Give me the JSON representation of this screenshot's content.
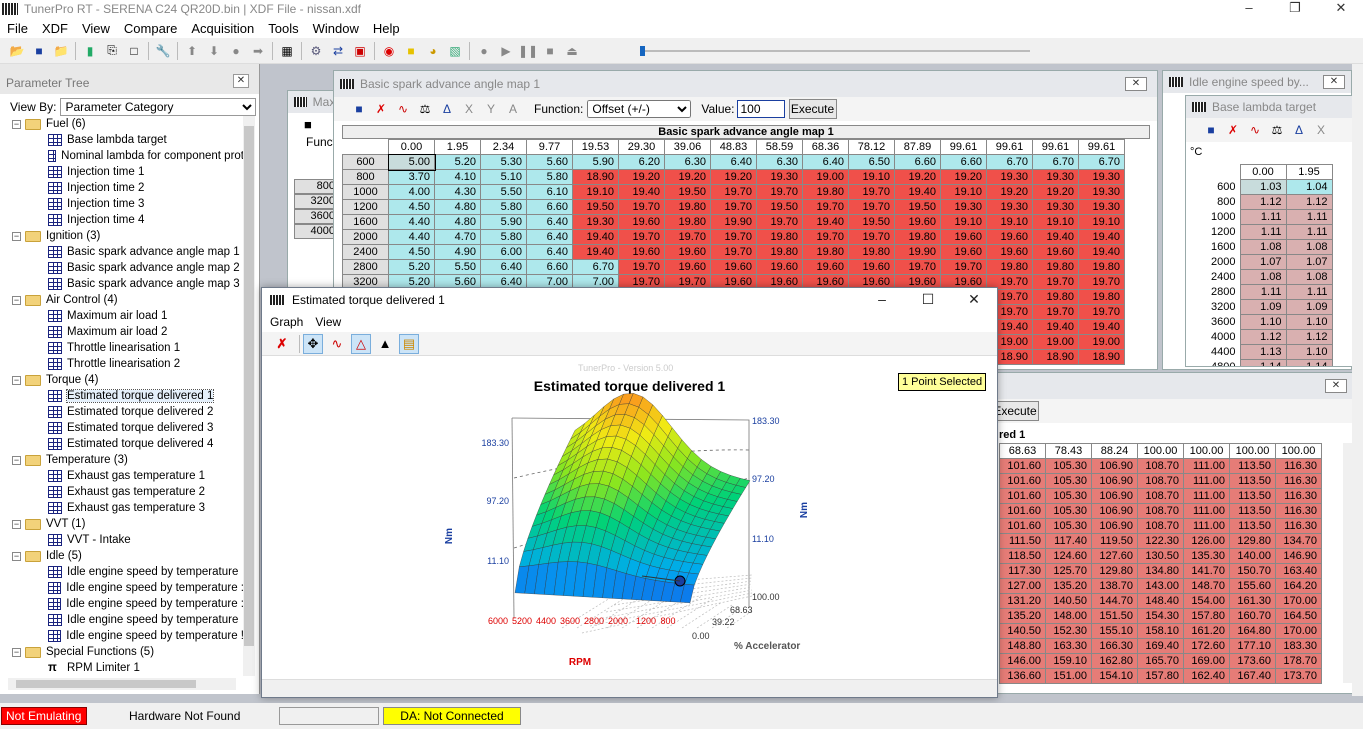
{
  "app": {
    "title": "TunerPro RT - SERENA C24 QR20D.bin | XDF File - nissan.xdf"
  },
  "menu": [
    "File",
    "XDF",
    "View",
    "Compare",
    "Acquisition",
    "Tools",
    "Window",
    "Help"
  ],
  "param_tree": {
    "header": "Parameter Tree",
    "view_by_label": "View By:",
    "view_by_value": "Parameter Category",
    "groups": [
      {
        "label": "Fuel (6)",
        "items": [
          "Base lambda target",
          "Nominal lambda for component prot",
          "Injection time 1",
          "Injection time 2",
          "Injection time 3",
          "Injection time 4"
        ]
      },
      {
        "label": "Ignition (3)",
        "items": [
          "Basic spark advance angle map 1",
          "Basic spark advance angle map 2",
          "Basic spark advance angle map 3"
        ]
      },
      {
        "label": "Air Control (4)",
        "items": [
          "Maximum air load 1",
          "Maximum air load 2",
          "Throttle linearisation 1",
          "Throttle linearisation 2"
        ]
      },
      {
        "label": "Torque (4)",
        "items": [
          "Estimated torque delivered 1",
          "Estimated torque delivered 2",
          "Estimated torque delivered 3",
          "Estimated torque delivered 4"
        ]
      },
      {
        "label": "Temperature (3)",
        "items": [
          "Exhaust gas temperature 1",
          "Exhaust gas temperature 2",
          "Exhaust gas temperature 3"
        ]
      },
      {
        "label": "VVT (1)",
        "items": [
          "VVT - Intake"
        ]
      },
      {
        "label": "Idle (5)",
        "items": [
          "Idle engine speed by temperature",
          "Idle engine speed by temperature :",
          "Idle engine speed by temperature :",
          "Idle engine speed by temperature",
          "Idle engine speed by temperature !"
        ]
      },
      {
        "label": "Special Functions (5)",
        "items": [
          "RPM Limiter 1"
        ]
      }
    ]
  },
  "spark": {
    "title": "Basic spark advance angle map 1",
    "function_label": "Function:",
    "function_value": "Offset (+/-)",
    "value_label": "Value:",
    "value": "100",
    "execute": "Execute",
    "table_title": "Basic spark advance angle map 1",
    "cols": [
      "0.00",
      "1.95",
      "2.34",
      "9.77",
      "19.53",
      "29.30",
      "39.06",
      "48.83",
      "58.59",
      "68.36",
      "78.12",
      "87.89",
      "99.61",
      "99.61",
      "99.61",
      "99.61"
    ],
    "rows": [
      {
        "y": "600",
        "v": [
          "5.00",
          "5.20",
          "5.30",
          "5.60",
          "5.90",
          "6.20",
          "6.30",
          "6.40",
          "6.30",
          "6.40",
          "6.50",
          "6.60",
          "6.60",
          "6.70",
          "6.70",
          "6.70"
        ]
      },
      {
        "y": "800",
        "v": [
          "3.70",
          "4.10",
          "5.10",
          "5.80",
          "18.90",
          "19.20",
          "19.20",
          "19.20",
          "19.30",
          "19.00",
          "19.10",
          "19.20",
          "19.20",
          "19.30",
          "19.30",
          "19.30"
        ]
      },
      {
        "y": "1000",
        "v": [
          "4.00",
          "4.30",
          "5.50",
          "6.10",
          "19.10",
          "19.40",
          "19.50",
          "19.70",
          "19.70",
          "19.80",
          "19.70",
          "19.40",
          "19.10",
          "19.20",
          "19.20",
          "19.30"
        ]
      },
      {
        "y": "1200",
        "v": [
          "4.50",
          "4.80",
          "5.80",
          "6.60",
          "19.50",
          "19.70",
          "19.80",
          "19.70",
          "19.50",
          "19.70",
          "19.70",
          "19.50",
          "19.30",
          "19.30",
          "19.30",
          "19.30"
        ]
      },
      {
        "y": "1600",
        "v": [
          "4.40",
          "4.80",
          "5.90",
          "6.40",
          "19.30",
          "19.60",
          "19.80",
          "19.90",
          "19.70",
          "19.40",
          "19.50",
          "19.60",
          "19.10",
          "19.10",
          "19.10",
          "19.10"
        ]
      },
      {
        "y": "2000",
        "v": [
          "4.40",
          "4.70",
          "5.80",
          "6.40",
          "19.40",
          "19.70",
          "19.70",
          "19.70",
          "19.80",
          "19.70",
          "19.70",
          "19.80",
          "19.60",
          "19.60",
          "19.40",
          "19.40"
        ]
      },
      {
        "y": "2400",
        "v": [
          "4.50",
          "4.90",
          "6.00",
          "6.40",
          "19.40",
          "19.60",
          "19.60",
          "19.70",
          "19.80",
          "19.80",
          "19.80",
          "19.90",
          "19.60",
          "19.60",
          "19.60",
          "19.40"
        ]
      },
      {
        "y": "2800",
        "v": [
          "5.20",
          "5.50",
          "6.40",
          "6.60",
          "6.70",
          "19.70",
          "19.60",
          "19.60",
          "19.60",
          "19.60",
          "19.60",
          "19.70",
          "19.70",
          "19.80",
          "19.80",
          "19.80"
        ]
      },
      {
        "y": "3200",
        "v": [
          "5.20",
          "5.60",
          "6.40",
          "7.00",
          "7.00",
          "19.70",
          "19.70",
          "19.60",
          "19.60",
          "19.60",
          "19.60",
          "19.60",
          "19.60",
          "19.70",
          "19.70",
          "19.70"
        ]
      }
    ],
    "extra_rows": [
      [
        "19.70",
        "19.80",
        "19.80"
      ],
      [
        "19.70",
        "19.70",
        "19.70"
      ],
      [
        "19.40",
        "19.40",
        "19.40"
      ],
      [
        "19.00",
        "19.00",
        "19.00"
      ],
      [
        "18.90",
        "18.90",
        "18.90"
      ]
    ]
  },
  "left_partial": {
    "title": "Maxi",
    "func": "Functi",
    "rows": [
      "800",
      "3200",
      "3600",
      "4000"
    ]
  },
  "idle": {
    "title": "Idle engine speed by..."
  },
  "lambda": {
    "title": "Base lambda target",
    "unit": "°C",
    "cols": [
      "0.00",
      "1.95"
    ],
    "rows": [
      {
        "y": "600",
        "v": [
          "1.03",
          "1.04"
        ]
      },
      {
        "y": "800",
        "v": [
          "1.12",
          "1.12"
        ]
      },
      {
        "y": "1000",
        "v": [
          "1.11",
          "1.11"
        ]
      },
      {
        "y": "1200",
        "v": [
          "1.11",
          "1.11"
        ]
      },
      {
        "y": "1600",
        "v": [
          "1.08",
          "1.08"
        ]
      },
      {
        "y": "2000",
        "v": [
          "1.07",
          "1.07"
        ]
      },
      {
        "y": "2400",
        "v": [
          "1.08",
          "1.08"
        ]
      },
      {
        "y": "2800",
        "v": [
          "1.11",
          "1.11"
        ]
      },
      {
        "y": "3200",
        "v": [
          "1.09",
          "1.09"
        ]
      },
      {
        "y": "3600",
        "v": [
          "1.10",
          "1.10"
        ]
      },
      {
        "y": "4000",
        "v": [
          "1.12",
          "1.12"
        ]
      },
      {
        "y": "4400",
        "v": [
          "1.13",
          "1.10"
        ]
      },
      {
        "y": "4800",
        "v": [
          "1.14",
          "1.14"
        ]
      }
    ]
  },
  "torque_tbl": {
    "execute": "Execute",
    "title": "red 1",
    "cols": [
      "68.63",
      "78.43",
      "88.24",
      "100.00",
      "100.00",
      "100.00",
      "100.00"
    ],
    "rows": [
      [
        "101.60",
        "105.30",
        "106.90",
        "108.70",
        "111.00",
        "113.50",
        "116.30"
      ],
      [
        "101.60",
        "105.30",
        "106.90",
        "108.70",
        "111.00",
        "113.50",
        "116.30"
      ],
      [
        "101.60",
        "105.30",
        "106.90",
        "108.70",
        "111.00",
        "113.50",
        "116.30"
      ],
      [
        "101.60",
        "105.30",
        "106.90",
        "108.70",
        "111.00",
        "113.50",
        "116.30"
      ],
      [
        "101.60",
        "105.30",
        "106.90",
        "108.70",
        "111.00",
        "113.50",
        "116.30"
      ],
      [
        "111.50",
        "117.40",
        "119.50",
        "122.30",
        "126.00",
        "129.80",
        "134.70"
      ],
      [
        "118.50",
        "124.60",
        "127.60",
        "130.50",
        "135.30",
        "140.00",
        "146.90"
      ],
      [
        "117.30",
        "125.70",
        "129.80",
        "134.80",
        "141.70",
        "150.70",
        "163.40"
      ],
      [
        "127.00",
        "135.20",
        "138.70",
        "143.00",
        "148.70",
        "155.60",
        "164.20"
      ],
      [
        "131.20",
        "140.50",
        "144.70",
        "148.40",
        "154.00",
        "161.30",
        "170.00"
      ],
      [
        "135.20",
        "148.00",
        "151.50",
        "154.30",
        "157.80",
        "160.70",
        "164.50"
      ],
      [
        "140.50",
        "152.30",
        "155.10",
        "158.10",
        "161.20",
        "164.80",
        "170.00"
      ],
      [
        "148.80",
        "163.30",
        "166.30",
        "169.40",
        "172.60",
        "177.10",
        "183.30"
      ],
      [
        "146.00",
        "159.10",
        "162.80",
        "165.70",
        "169.00",
        "173.60",
        "178.70"
      ],
      [
        "136.60",
        "151.00",
        "154.10",
        "157.80",
        "162.40",
        "167.40",
        "173.70"
      ]
    ]
  },
  "graph": {
    "title": "Estimated torque delivered 1",
    "menu": [
      "Graph",
      "View"
    ],
    "watermark": "TunerPro - Version 5.00",
    "selected": "1 Point Selected",
    "left_ticks": [
      "183.30",
      "97.20",
      "11.10"
    ],
    "right_ticks": [
      "183.30",
      "97.20",
      "11.10"
    ],
    "unit": "Nm",
    "rpm_ticks": [
      "6000",
      "5200",
      "4400",
      "3600",
      "2800",
      "2000",
      "1200",
      "800"
    ],
    "rpm_label": "RPM",
    "accel_ticks": [
      "0.00",
      "39.22",
      "68.63",
      "100.00"
    ],
    "accel_label": "% Accelerator"
  },
  "status": {
    "emul": "Not Emulating",
    "hw": "Hardware Not Found",
    "da": "DA: Not Connected"
  }
}
